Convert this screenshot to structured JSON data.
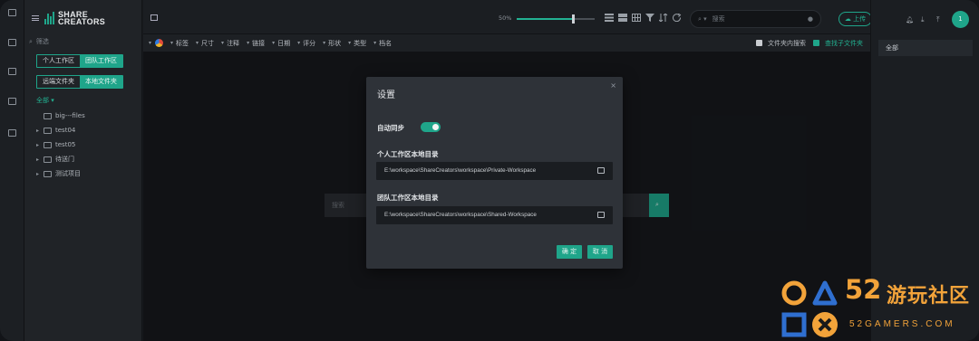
{
  "app": {
    "logo_text_line1": "SHARE",
    "logo_text_line2": "CREATORS"
  },
  "sidebar": {
    "filter_placeholder": "筛选",
    "workspace_tabs": [
      "个人工作区",
      "团队工作区"
    ],
    "workspace_active": 1,
    "folder_tabs": [
      "远端文件夹",
      "本地文件夹"
    ],
    "folder_active": 1,
    "tree_all": "全部",
    "tree": [
      "big---files",
      "test04",
      "test05",
      "待送门",
      "测试项目"
    ]
  },
  "topbar": {
    "zoom": "50%",
    "zoom_level": 0.72,
    "search_placeholder": "搜索",
    "upload_label": "上传",
    "avatar_letter": "1"
  },
  "filterbar": {
    "items": [
      "标签",
      "尺寸",
      "注释",
      "链接",
      "日期",
      "评分",
      "形状",
      "类型",
      "档名"
    ],
    "folder_search_label": "文件夹内搜索",
    "include_subfolders_label": "查找子文件夹",
    "include_subfolders": true
  },
  "content": {
    "search_placeholder": "搜索"
  },
  "right_panel": {
    "all_label": "全部"
  },
  "dialog": {
    "title": "设置",
    "autosync_label": "自动同步",
    "autosync": true,
    "personal_dir_label": "个人工作区本地目录",
    "personal_dir_value": "E:\\workspace\\ShareCreators\\workspace\\Private-Workspace",
    "team_dir_label": "团队工作区本地目录",
    "team_dir_value": "E:\\workspace\\ShareCreators\\workspace\\Shared-Workspace",
    "confirm_label": "确 定",
    "cancel_label": "取 消"
  },
  "watermark": {
    "number": "52",
    "name": "游玩社区",
    "site": "52GAMERS.COM"
  },
  "colors": {
    "accent": "#1fa58a",
    "watermark": "#f2a33a"
  }
}
